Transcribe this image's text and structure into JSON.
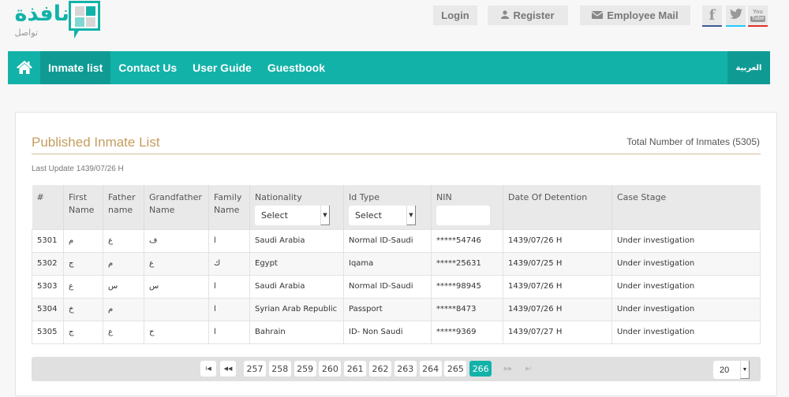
{
  "brand": {
    "name_ar": "نافذة",
    "subtitle_ar": "تواصل",
    "colors": {
      "primary": "#12b2a9",
      "primary_dark": "#0f9b94",
      "accent_gold": "#c59d5f"
    }
  },
  "topbar": {
    "login": "Login",
    "register": "Register",
    "employee_mail": "Employee Mail",
    "social": [
      {
        "name": "facebook",
        "glyph": "f",
        "color": "#3b5998"
      },
      {
        "name": "twitter",
        "glyph": "t",
        "color": "#1dcaff"
      },
      {
        "name": "youtube",
        "glyph": "You Tube",
        "color": "#e52d27"
      }
    ]
  },
  "nav": {
    "items": [
      {
        "label": "Inmate list",
        "active": true
      },
      {
        "label": "Contact Us",
        "active": false
      },
      {
        "label": "User Guide",
        "active": false
      },
      {
        "label": "Guestbook",
        "active": false
      }
    ],
    "language": "العربية"
  },
  "panel": {
    "title": "Published Inmate List",
    "total": "Total Number of Inmates (5305)",
    "last_update": "Last Update 1439/07/26 H"
  },
  "table": {
    "columns": [
      {
        "label": "#"
      },
      {
        "label": "First Name"
      },
      {
        "label": "Father name"
      },
      {
        "label": "Grandfather Name"
      },
      {
        "label": "Family Name"
      },
      {
        "label": "Nationality",
        "filter": "select",
        "value": "Select"
      },
      {
        "label": "Id Type",
        "filter": "select",
        "value": "Select"
      },
      {
        "label": "NIN",
        "filter": "input",
        "value": ""
      },
      {
        "label": "Date Of Detention"
      },
      {
        "label": "Case Stage"
      }
    ],
    "rows": [
      [
        "5301",
        "م",
        "ع",
        "ف",
        "ا",
        "Saudi Arabia",
        "Normal ID-Saudi",
        "*****54746",
        "1439/07/26 H",
        "Under investigation"
      ],
      [
        "5302",
        "ج",
        "م",
        "ع",
        "ك",
        "Egypt",
        "Iqama",
        "*****25631",
        "1439/07/25 H",
        "Under investigation"
      ],
      [
        "5303",
        "ع",
        "س",
        "س",
        "ا",
        "Saudi Arabia",
        "Normal ID-Saudi",
        "*****98945",
        "1439/07/26 H",
        "Under investigation"
      ],
      [
        "5304",
        "خ",
        "م",
        "",
        "ا",
        "Syrian Arab Republic",
        "Passport",
        "*****8473",
        "1439/07/26 H",
        "Under investigation"
      ],
      [
        "5305",
        "ج",
        "ع",
        "ح",
        "ا",
        "Bahrain",
        "ID- Non Saudi",
        "*****9369",
        "1439/07/27 H",
        "Under investigation"
      ]
    ]
  },
  "pager": {
    "first_glyph": "I◀",
    "prev_glyph": "◀◀",
    "next_glyph": "▶▶",
    "last_glyph": "▶I",
    "pages": [
      "257",
      "258",
      "259",
      "260",
      "261",
      "262",
      "263",
      "264",
      "265",
      "266"
    ],
    "current_page": "266",
    "page_size": "20"
  }
}
